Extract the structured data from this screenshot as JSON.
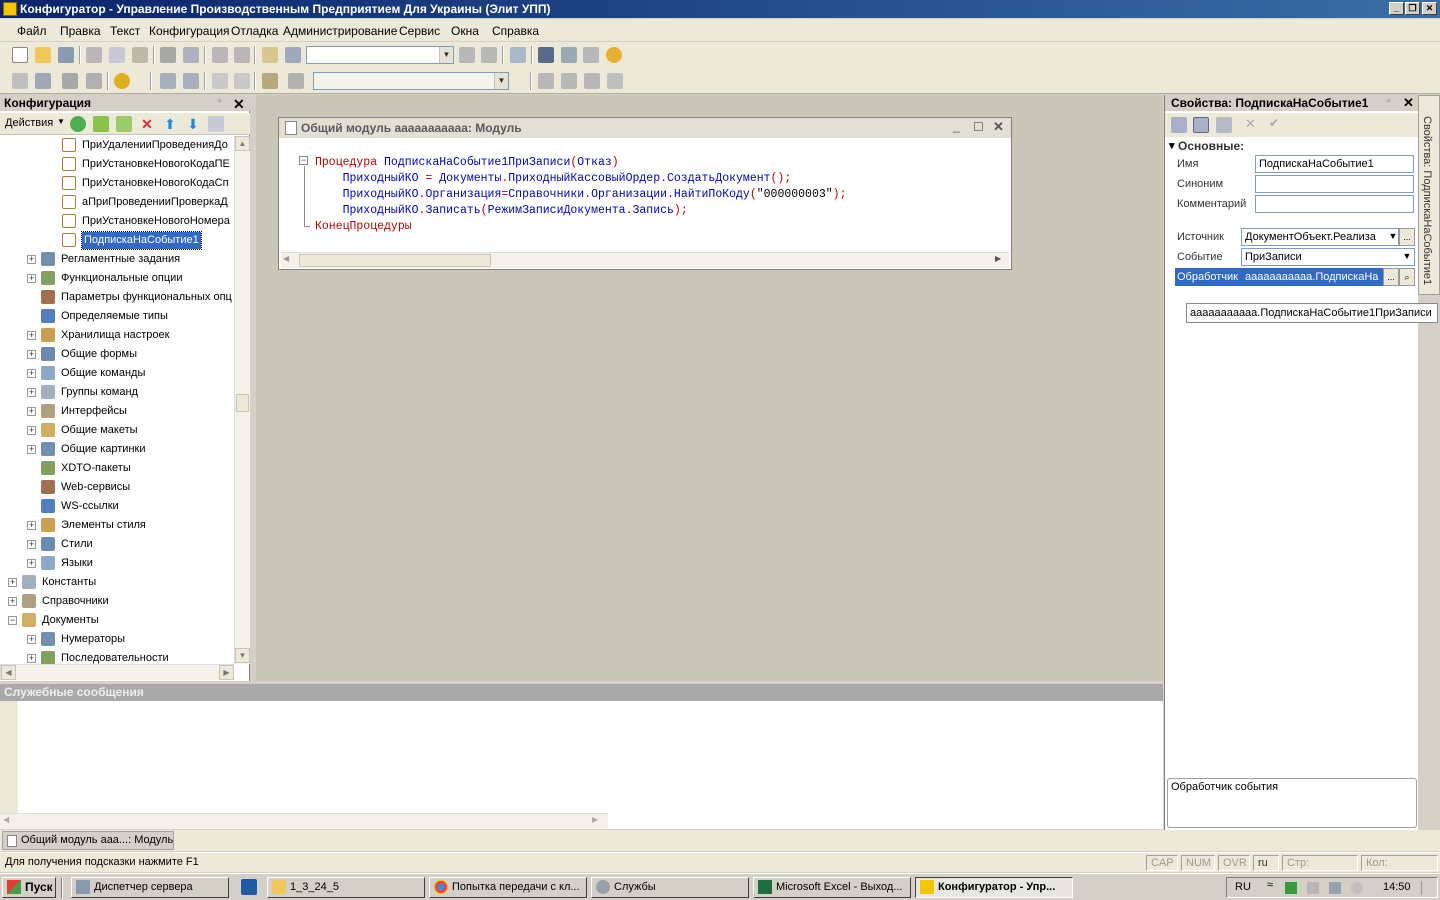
{
  "title_bar": {
    "title": "Конфигуратор - Управление Производственным Предприятием Для Украины (Элит УПП)",
    "buttons": [
      "_",
      "❐",
      "✕"
    ]
  },
  "menu": [
    "Файл",
    "Правка",
    "Текст",
    "Конфигурация",
    "Отладка",
    "Администрирование",
    "Сервис",
    "Окна",
    "Справка"
  ],
  "config_panel": {
    "title": "Конфигурация",
    "actions_label": "Действия",
    "tree": [
      {
        "label": "ПриУдаленииПроведенияДо",
        "icon": "subscription-icon",
        "level": 3,
        "expand": ""
      },
      {
        "label": "ПриУстановкеНовогоКодаПЕ",
        "icon": "subscription-icon",
        "level": 3,
        "expand": ""
      },
      {
        "label": "ПриУстановкеНовогоКодаСп",
        "icon": "subscription-icon",
        "level": 3,
        "expand": ""
      },
      {
        "label": "аПриПроведенииПроверкаД",
        "icon": "subscription-icon",
        "level": 3,
        "expand": ""
      },
      {
        "label": "ПриУстановкеНовогоНомера",
        "icon": "subscription-icon",
        "level": 3,
        "expand": ""
      },
      {
        "label": "ПодпискаНаСобытие1",
        "icon": "subscription-icon",
        "level": 3,
        "expand": "",
        "selected": true
      },
      {
        "label": "Регламентные задания",
        "icon": "clock-icon",
        "level": 2,
        "expand": "+"
      },
      {
        "label": "Функциональные опции",
        "icon": "functional-option-icon",
        "level": 2,
        "expand": "+"
      },
      {
        "label": "Параметры функциональных опц",
        "icon": "parameter-icon",
        "level": 2,
        "expand": ""
      },
      {
        "label": "Определяемые типы",
        "icon": "types-icon",
        "level": 2,
        "expand": ""
      },
      {
        "label": "Хранилища настроек",
        "icon": "storage-icon",
        "level": 2,
        "expand": "+"
      },
      {
        "label": "Общие формы",
        "icon": "form-icon",
        "level": 2,
        "expand": "+"
      },
      {
        "label": "Общие команды",
        "icon": "command-icon",
        "level": 2,
        "expand": "+"
      },
      {
        "label": "Группы команд",
        "icon": "folder-icon",
        "level": 2,
        "expand": "+"
      },
      {
        "label": "Интерфейсы",
        "icon": "interface-icon",
        "level": 2,
        "expand": "+"
      },
      {
        "label": "Общие макеты",
        "icon": "template-icon",
        "level": 2,
        "expand": "+"
      },
      {
        "label": "Общие картинки",
        "icon": "picture-icon",
        "level": 2,
        "expand": "+"
      },
      {
        "label": "XDTO-пакеты",
        "icon": "xdto-icon",
        "level": 2,
        "expand": ""
      },
      {
        "label": "Web-сервисы",
        "icon": "web-service-icon",
        "level": 2,
        "expand": ""
      },
      {
        "label": "WS-ссылки",
        "icon": "ws-link-icon",
        "level": 2,
        "expand": ""
      },
      {
        "label": "Элементы стиля",
        "icon": "style-element-icon",
        "level": 2,
        "expand": "+"
      },
      {
        "label": "Стили",
        "icon": "style-icon",
        "level": 2,
        "expand": "+"
      },
      {
        "label": "Языки",
        "icon": "language-icon",
        "level": 2,
        "expand": "+"
      },
      {
        "label": "Константы",
        "icon": "constant-icon",
        "level": 1,
        "expand": "+"
      },
      {
        "label": "Справочники",
        "icon": "catalog-icon",
        "level": 1,
        "expand": "+"
      },
      {
        "label": "Документы",
        "icon": "document-icon",
        "level": 1,
        "expand": "-"
      },
      {
        "label": "Нумераторы",
        "icon": "numerator-icon",
        "level": 2,
        "expand": "+"
      },
      {
        "label": "Последовательности",
        "icon": "sequence-icon",
        "level": 2,
        "expand": "+"
      }
    ]
  },
  "module_window": {
    "title": "Общий модуль ааааааааааа: Модуль",
    "code": [
      [
        {
          "t": "Процедура ",
          "c": "kw"
        },
        {
          "t": "ПодпискаНаСобытие1ПриЗаписи",
          "c": "id"
        },
        {
          "t": "(",
          "c": "pt"
        },
        {
          "t": "Отказ",
          "c": "id"
        },
        {
          "t": ")",
          "c": "pt"
        }
      ],
      [
        {
          "t": "    ПриходныйКО ",
          "c": "id"
        },
        {
          "t": "= ",
          "c": "pt"
        },
        {
          "t": "Документы",
          "c": "id"
        },
        {
          "t": ".",
          "c": "pt"
        },
        {
          "t": "ПриходныйКассовыйОрдер",
          "c": "id"
        },
        {
          "t": ".",
          "c": "pt"
        },
        {
          "t": "СоздатьДокумент",
          "c": "id"
        },
        {
          "t": "();",
          "c": "pt"
        }
      ],
      [
        {
          "t": "    ПриходныйКО",
          "c": "id"
        },
        {
          "t": ".",
          "c": "pt"
        },
        {
          "t": "Организация",
          "c": "id"
        },
        {
          "t": "=",
          "c": "pt"
        },
        {
          "t": "Справочники",
          "c": "id"
        },
        {
          "t": ".",
          "c": "pt"
        },
        {
          "t": "Организации",
          "c": "id"
        },
        {
          "t": ".",
          "c": "pt"
        },
        {
          "t": "НайтиПоКоду",
          "c": "id"
        },
        {
          "t": "(",
          "c": "pt"
        },
        {
          "t": "\"000000003\"",
          "c": "str"
        },
        {
          "t": ");",
          "c": "pt"
        }
      ],
      [
        {
          "t": "    ПриходныйКО",
          "c": "id"
        },
        {
          "t": ".",
          "c": "pt"
        },
        {
          "t": "Записать",
          "c": "id"
        },
        {
          "t": "(",
          "c": "pt"
        },
        {
          "t": "РежимЗаписиДокумента",
          "c": "id"
        },
        {
          "t": ".",
          "c": "pt"
        },
        {
          "t": "Запись",
          "c": "id"
        },
        {
          "t": ");",
          "c": "pt"
        }
      ],
      [
        {
          "t": "КонецПроцедуры",
          "c": "kw"
        }
      ]
    ],
    "colors": {
      "kw": "#c00000",
      "id": "#0000c0",
      "pt": "#c00000",
      "str": "#000000"
    }
  },
  "properties": {
    "title": "Свойства: ПодпискаНаСобытие1",
    "section": "Основные:",
    "fields": {
      "name_label": "Имя",
      "name_value": "ПодпискаНаСобытие1",
      "synonym_label": "Синоним",
      "synonym_value": "",
      "comment_label": "Комментарий",
      "comment_value": "",
      "source_label": "Источник",
      "source_value": "ДокументОбъект.Реализа",
      "event_label": "Событие",
      "event_value": "ПриЗаписи",
      "handler_label": "Обработчик",
      "handler_value": "ааааааааааа.ПодпискаНа"
    },
    "tooltip": "ааааааааааа.ПодпискаНаСобытие1ПриЗаписи",
    "description": "Обработчик события",
    "vertical_tab": "Свойства: ПодпискаНаСобытие1"
  },
  "messages": {
    "title": "Служебные сообщения"
  },
  "window_tab": "Общий модуль ааа...: Модуль",
  "status_bar": {
    "hint": "Для получения подсказки нажмите F1",
    "cap": "CAP",
    "num": "NUM",
    "ovr": "OVR",
    "lang": "ru",
    "line": "Стр:",
    "col": "Кол:"
  },
  "taskbar": {
    "start": "Пуск",
    "items": [
      {
        "label": "Диспетчер сервера",
        "icon": "server-manager-icon",
        "active": false
      },
      {
        "label": "",
        "icon": "powershell-icon",
        "active": false
      },
      {
        "label": "1_3_24_5",
        "icon": "folder-icon",
        "active": false
      },
      {
        "label": "Попытка передачи с кл...",
        "icon": "chrome-icon",
        "active": false
      },
      {
        "label": "Службы",
        "icon": "services-icon",
        "active": false
      },
      {
        "label": "Microsoft Excel - Выход...",
        "icon": "excel-icon",
        "active": false
      },
      {
        "label": "Конфигуратор - Упр...",
        "icon": "1c-icon",
        "active": true
      }
    ],
    "lang": "RU",
    "time": "14:50"
  }
}
